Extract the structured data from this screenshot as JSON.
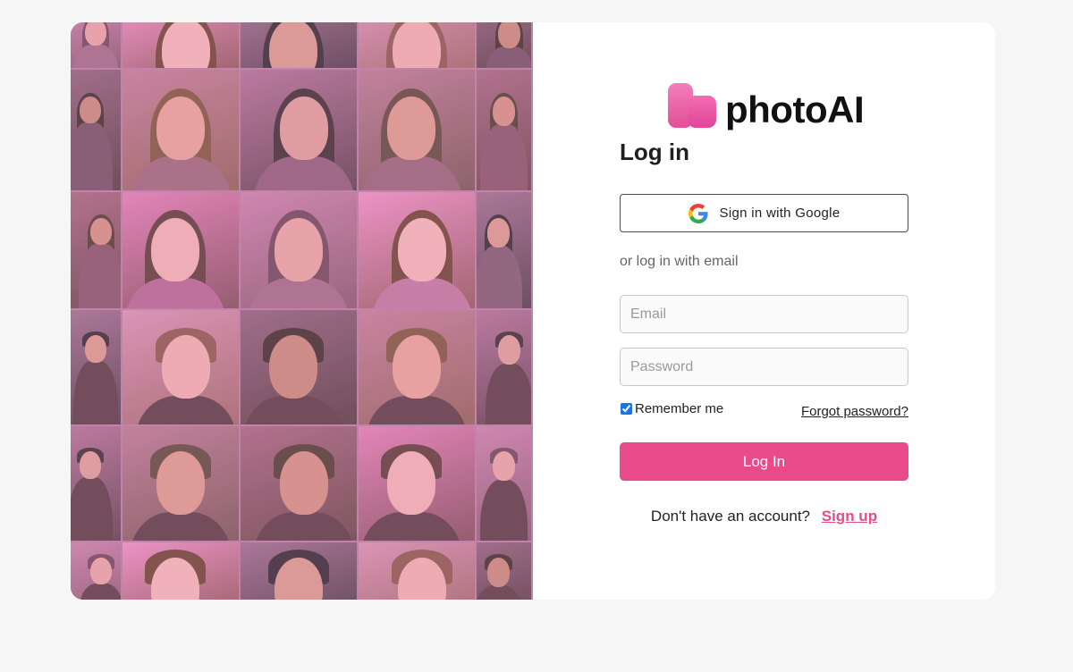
{
  "brand": {
    "name": "photoAI",
    "accent_color": "#e94a89"
  },
  "login": {
    "title": "Log in",
    "google_button_label": "Sign in with Google",
    "or_text": "or log in with email",
    "email_placeholder": "Email",
    "password_placeholder": "Password",
    "remember_label": "Remember me",
    "remember_checked": true,
    "forgot_label": "Forgot password?",
    "submit_label": "Log In",
    "signup_prompt": "Don't have an account?",
    "signup_link": "Sign up"
  },
  "collage": {
    "icon": "portrait-photo-collage"
  }
}
